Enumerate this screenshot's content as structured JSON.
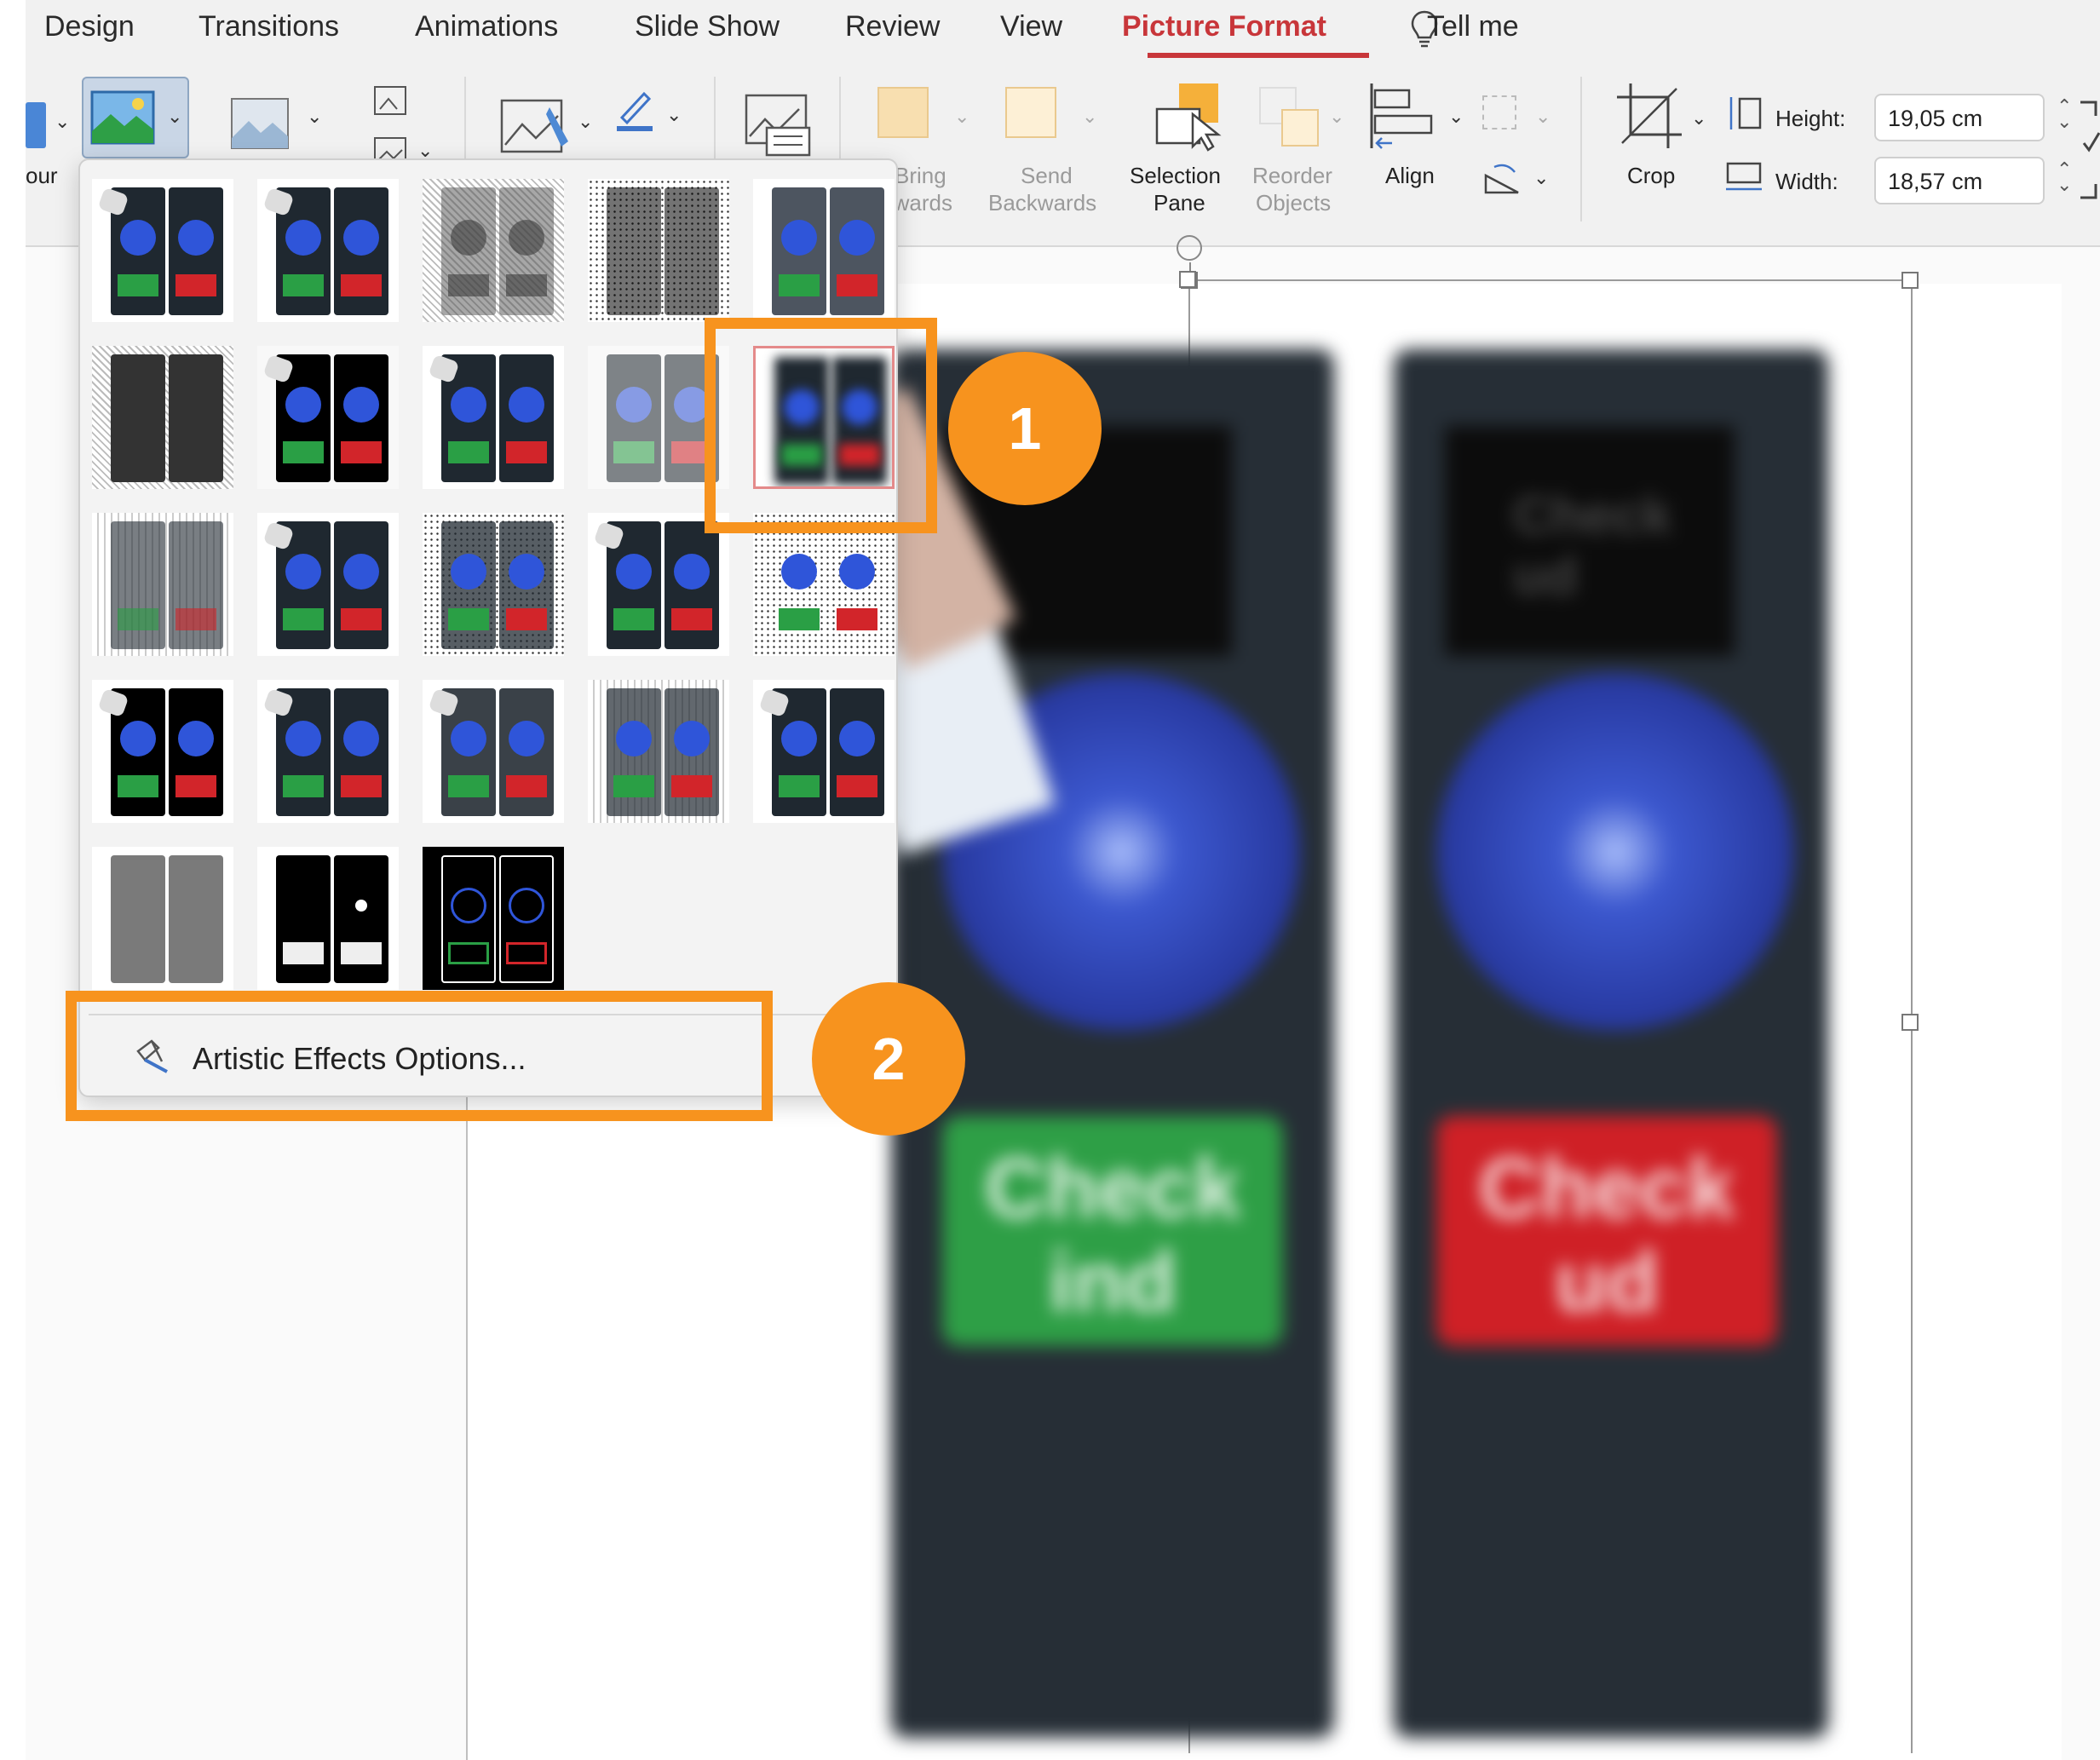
{
  "tabs": [
    {
      "label": "Design"
    },
    {
      "label": "Transitions"
    },
    {
      "label": "Animations"
    },
    {
      "label": "Slide Show"
    },
    {
      "label": "Review"
    },
    {
      "label": "View"
    },
    {
      "label": "Picture Format",
      "active": true
    },
    {
      "label": "Tell me"
    }
  ],
  "ribbon": {
    "colour_partial": "our",
    "bring_forward": {
      "line1": "Bring",
      "line2": "rwards"
    },
    "send_backwards": {
      "line1": "Send",
      "line2": "Backwards"
    },
    "selection_pane": {
      "line1": "Selection",
      "line2": "Pane"
    },
    "reorder_objects": {
      "line1": "Reorder",
      "line2": "Objects"
    },
    "align": "Align",
    "crop": "Crop",
    "height_label": "Height:",
    "height_value": "19,05 cm",
    "width_label": "Width:",
    "width_value": "18,57 cm"
  },
  "gallery": {
    "options_label": "Artistic Effects Options...",
    "thumbnails": [
      "none",
      "marker",
      "pencil-grayscale",
      "pencil-sketch",
      "line-drawing",
      "chalk-sketch",
      "paint-strokes",
      "paint-brush",
      "glow-diffused",
      "blur",
      "light-screen",
      "watercolor-sponge",
      "film-grain",
      "mosaic-bubbles",
      "glass",
      "cement",
      "texturizer",
      "crisscross-etching",
      "pastels-smooth",
      "plastic-wrap",
      "cutout",
      "photocopy",
      "glow-edges"
    ]
  },
  "slide": {
    "checkin_text": "Check ind",
    "checkout_text": "Check ud",
    "screen_text": "Check ud"
  },
  "callouts": {
    "badge1": "1",
    "badge2": "2",
    "accent_color": "#f7931e"
  },
  "colors": {
    "active_tab": "#c8363a",
    "checkin_green": "#2e9f46",
    "checkout_red": "#cf2026",
    "orb_blue": "#2f55d9"
  }
}
